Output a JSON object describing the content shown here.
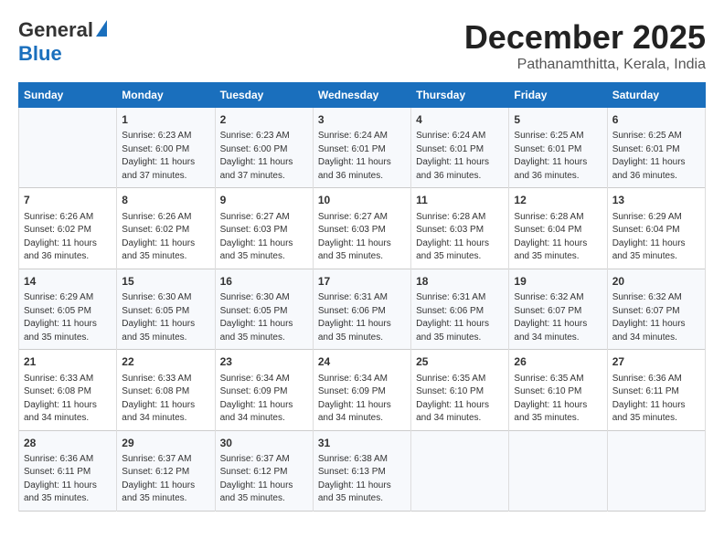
{
  "header": {
    "logo_general": "General",
    "logo_blue": "Blue",
    "month_title": "December 2025",
    "location": "Pathanamthitta, Kerala, India"
  },
  "days_of_week": [
    "Sunday",
    "Monday",
    "Tuesday",
    "Wednesday",
    "Thursday",
    "Friday",
    "Saturday"
  ],
  "weeks": [
    [
      {
        "date": "",
        "info": ""
      },
      {
        "date": "1",
        "info": "Sunrise: 6:23 AM\nSunset: 6:00 PM\nDaylight: 11 hours\nand 37 minutes."
      },
      {
        "date": "2",
        "info": "Sunrise: 6:23 AM\nSunset: 6:00 PM\nDaylight: 11 hours\nand 37 minutes."
      },
      {
        "date": "3",
        "info": "Sunrise: 6:24 AM\nSunset: 6:01 PM\nDaylight: 11 hours\nand 36 minutes."
      },
      {
        "date": "4",
        "info": "Sunrise: 6:24 AM\nSunset: 6:01 PM\nDaylight: 11 hours\nand 36 minutes."
      },
      {
        "date": "5",
        "info": "Sunrise: 6:25 AM\nSunset: 6:01 PM\nDaylight: 11 hours\nand 36 minutes."
      },
      {
        "date": "6",
        "info": "Sunrise: 6:25 AM\nSunset: 6:01 PM\nDaylight: 11 hours\nand 36 minutes."
      }
    ],
    [
      {
        "date": "7",
        "info": "Sunrise: 6:26 AM\nSunset: 6:02 PM\nDaylight: 11 hours\nand 36 minutes."
      },
      {
        "date": "8",
        "info": "Sunrise: 6:26 AM\nSunset: 6:02 PM\nDaylight: 11 hours\nand 35 minutes."
      },
      {
        "date": "9",
        "info": "Sunrise: 6:27 AM\nSunset: 6:03 PM\nDaylight: 11 hours\nand 35 minutes."
      },
      {
        "date": "10",
        "info": "Sunrise: 6:27 AM\nSunset: 6:03 PM\nDaylight: 11 hours\nand 35 minutes."
      },
      {
        "date": "11",
        "info": "Sunrise: 6:28 AM\nSunset: 6:03 PM\nDaylight: 11 hours\nand 35 minutes."
      },
      {
        "date": "12",
        "info": "Sunrise: 6:28 AM\nSunset: 6:04 PM\nDaylight: 11 hours\nand 35 minutes."
      },
      {
        "date": "13",
        "info": "Sunrise: 6:29 AM\nSunset: 6:04 PM\nDaylight: 11 hours\nand 35 minutes."
      }
    ],
    [
      {
        "date": "14",
        "info": "Sunrise: 6:29 AM\nSunset: 6:05 PM\nDaylight: 11 hours\nand 35 minutes."
      },
      {
        "date": "15",
        "info": "Sunrise: 6:30 AM\nSunset: 6:05 PM\nDaylight: 11 hours\nand 35 minutes."
      },
      {
        "date": "16",
        "info": "Sunrise: 6:30 AM\nSunset: 6:05 PM\nDaylight: 11 hours\nand 35 minutes."
      },
      {
        "date": "17",
        "info": "Sunrise: 6:31 AM\nSunset: 6:06 PM\nDaylight: 11 hours\nand 35 minutes."
      },
      {
        "date": "18",
        "info": "Sunrise: 6:31 AM\nSunset: 6:06 PM\nDaylight: 11 hours\nand 35 minutes."
      },
      {
        "date": "19",
        "info": "Sunrise: 6:32 AM\nSunset: 6:07 PM\nDaylight: 11 hours\nand 34 minutes."
      },
      {
        "date": "20",
        "info": "Sunrise: 6:32 AM\nSunset: 6:07 PM\nDaylight: 11 hours\nand 34 minutes."
      }
    ],
    [
      {
        "date": "21",
        "info": "Sunrise: 6:33 AM\nSunset: 6:08 PM\nDaylight: 11 hours\nand 34 minutes."
      },
      {
        "date": "22",
        "info": "Sunrise: 6:33 AM\nSunset: 6:08 PM\nDaylight: 11 hours\nand 34 minutes."
      },
      {
        "date": "23",
        "info": "Sunrise: 6:34 AM\nSunset: 6:09 PM\nDaylight: 11 hours\nand 34 minutes."
      },
      {
        "date": "24",
        "info": "Sunrise: 6:34 AM\nSunset: 6:09 PM\nDaylight: 11 hours\nand 34 minutes."
      },
      {
        "date": "25",
        "info": "Sunrise: 6:35 AM\nSunset: 6:10 PM\nDaylight: 11 hours\nand 34 minutes."
      },
      {
        "date": "26",
        "info": "Sunrise: 6:35 AM\nSunset: 6:10 PM\nDaylight: 11 hours\nand 35 minutes."
      },
      {
        "date": "27",
        "info": "Sunrise: 6:36 AM\nSunset: 6:11 PM\nDaylight: 11 hours\nand 35 minutes."
      }
    ],
    [
      {
        "date": "28",
        "info": "Sunrise: 6:36 AM\nSunset: 6:11 PM\nDaylight: 11 hours\nand 35 minutes."
      },
      {
        "date": "29",
        "info": "Sunrise: 6:37 AM\nSunset: 6:12 PM\nDaylight: 11 hours\nand 35 minutes."
      },
      {
        "date": "30",
        "info": "Sunrise: 6:37 AM\nSunset: 6:12 PM\nDaylight: 11 hours\nand 35 minutes."
      },
      {
        "date": "31",
        "info": "Sunrise: 6:38 AM\nSunset: 6:13 PM\nDaylight: 11 hours\nand 35 minutes."
      },
      {
        "date": "",
        "info": ""
      },
      {
        "date": "",
        "info": ""
      },
      {
        "date": "",
        "info": ""
      }
    ]
  ]
}
